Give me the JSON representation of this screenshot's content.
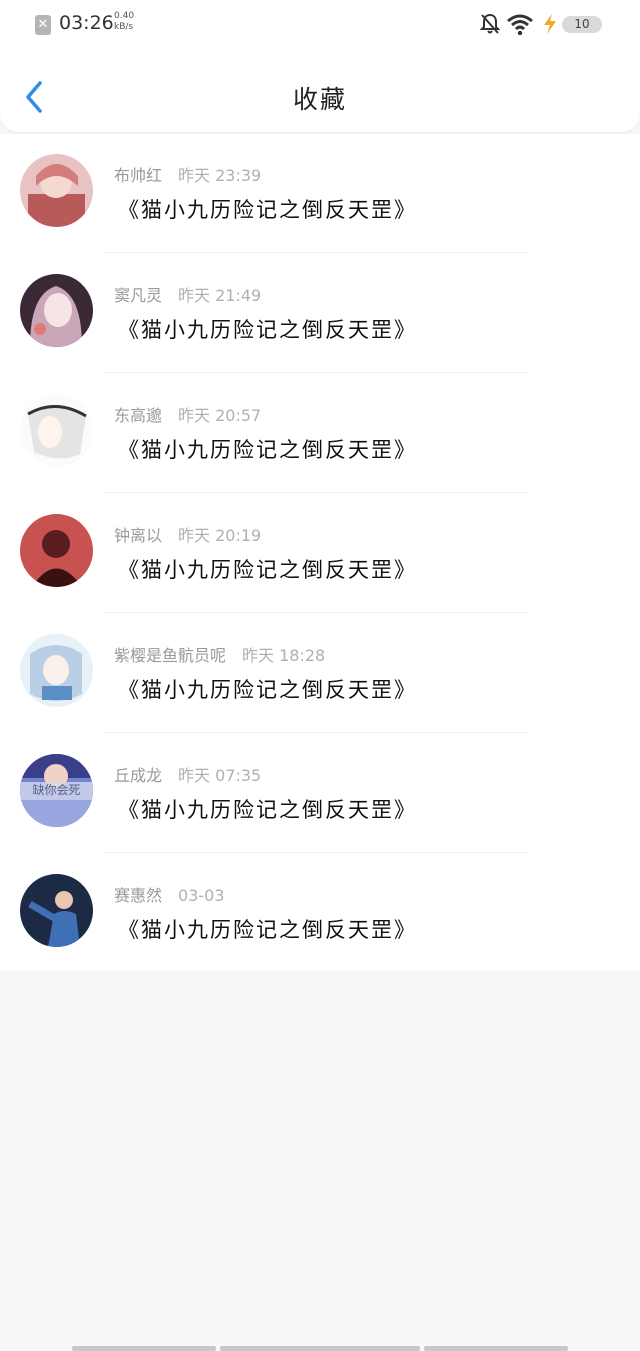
{
  "status_bar": {
    "close_glyph": "✕",
    "time": "03:26",
    "speed_value": "0.40",
    "speed_unit": "kB/s",
    "battery": "10",
    "icons": [
      "close-icon",
      "bell-off-icon",
      "wifi-icon",
      "charging-bolt-icon",
      "battery-icon"
    ]
  },
  "header": {
    "title": "收藏",
    "back_icon": "chevron-left-icon"
  },
  "items": [
    {
      "name": "布帅红",
      "time": "昨天 23:39",
      "title": "《猫小九历险记之倒反天罡》",
      "avatar_color": "#d98a8a"
    },
    {
      "name": "窦凡灵",
      "time": "昨天 21:49",
      "title": "《猫小九历险记之倒反天罡》",
      "avatar_color": "#c9a6b8"
    },
    {
      "name": "东高邈",
      "time": "昨天 20:57",
      "title": "《猫小九历险记之倒反天罡》",
      "avatar_color": "#e8e6e6"
    },
    {
      "name": "钟离以",
      "time": "昨天 20:19",
      "title": "《猫小九历险记之倒反天罡》",
      "avatar_color": "#b84a4a"
    },
    {
      "name": "紫樱是鱼骯员呢",
      "time": "昨天 18:28",
      "title": "《猫小九历险记之倒反天罡》",
      "avatar_color": "#b9cfe6"
    },
    {
      "name": "丘成龙",
      "time": "昨天 07:35",
      "title": "《猫小九历险记之倒反天罡》",
      "avatar_color": "#6a78c9",
      "avatar_text": "缺你会死"
    },
    {
      "name": "赛惠然",
      "time": "03-03",
      "title": "《猫小九历险记之倒反天罡》",
      "avatar_color": "#2b3a5a"
    }
  ],
  "colors": {
    "accent": "#2f8de4",
    "page_bg": "#f8f6f7",
    "card_bg": "#ffffff"
  }
}
